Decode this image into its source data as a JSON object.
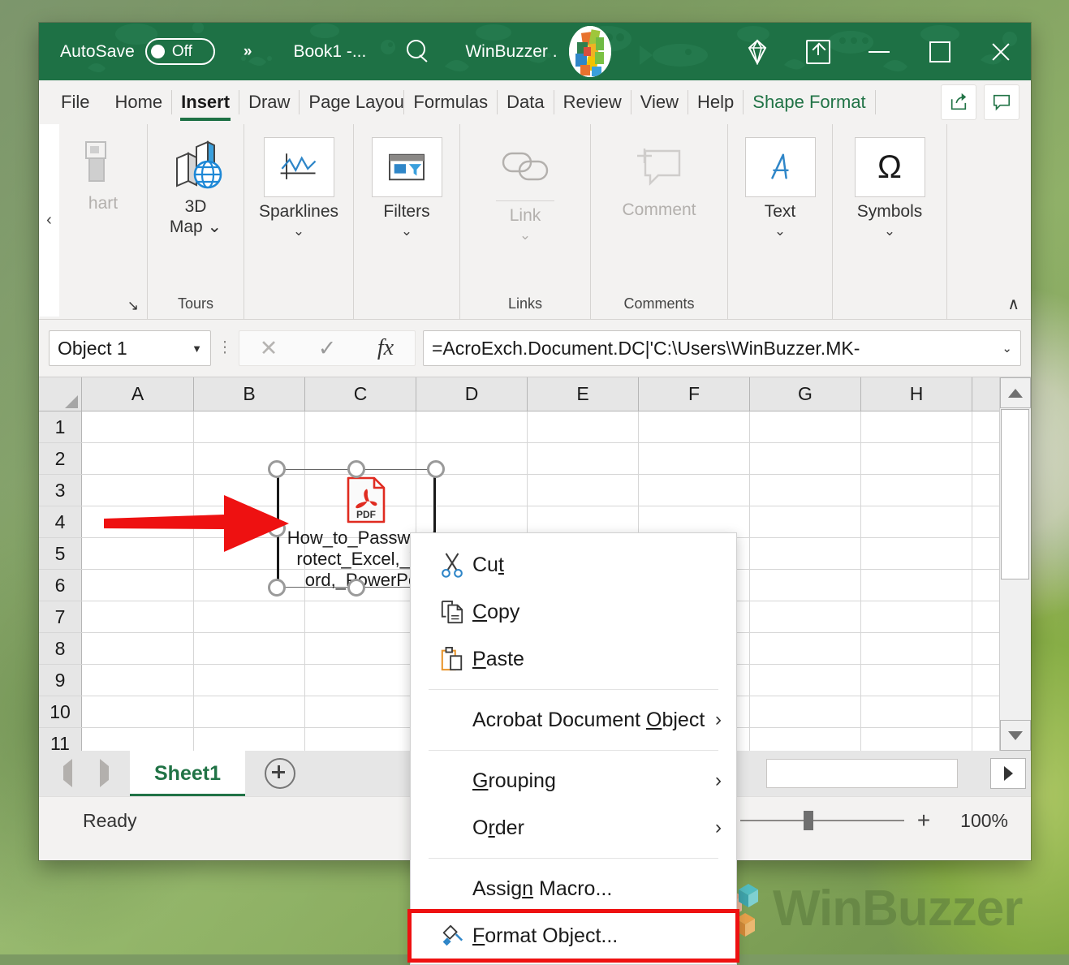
{
  "app": "Microsoft Excel",
  "titlebar": {
    "autosave_label": "AutoSave",
    "autosave_state": "Off",
    "qat_more": "»",
    "document_title": "Book1  -...",
    "search_icon": "search-icon",
    "user_name": "WinBuzzer .",
    "avatar": "user-avatar",
    "buttons": {
      "diamond": "diamond-icon",
      "ribbon_display": "ribbon-display-options-icon",
      "minimize": "minimize-icon",
      "maximize": "maximize-icon",
      "close": "close-icon"
    }
  },
  "tabs": [
    {
      "label": "File",
      "active": false,
      "contextual": false
    },
    {
      "label": "Home",
      "active": false,
      "contextual": false
    },
    {
      "label": "Insert",
      "active": true,
      "contextual": false
    },
    {
      "label": "Draw",
      "active": false,
      "contextual": false
    },
    {
      "label": "Page Layout",
      "active": false,
      "contextual": false,
      "clipped": true
    },
    {
      "label": "Formulas",
      "active": false,
      "contextual": false
    },
    {
      "label": "Data",
      "active": false,
      "contextual": false
    },
    {
      "label": "Review",
      "active": false,
      "contextual": false
    },
    {
      "label": "View",
      "active": false,
      "contextual": false
    },
    {
      "label": "Help",
      "active": false,
      "contextual": false
    },
    {
      "label": "Shape Format",
      "active": false,
      "contextual": true
    }
  ],
  "tabstrip_right": {
    "share": "share-icon",
    "comments": "comments-icon"
  },
  "ribbon": {
    "scroll_left": "‹",
    "groups": [
      {
        "name": "charts",
        "label": "",
        "clipped": true,
        "buttons": [
          {
            "label": "hart",
            "icon": "pivotchart-icon",
            "dim": true,
            "chevron": false
          }
        ],
        "dialog_launcher": "↘"
      },
      {
        "name": "tours",
        "label": "Tours",
        "buttons": [
          {
            "label": "3D\nMap ⌄",
            "icon": "3d-map-icon",
            "dim": false,
            "chevron": false
          }
        ]
      },
      {
        "name": "sparklines",
        "label": "",
        "buttons": [
          {
            "label": "Sparklines",
            "icon": "sparklines-icon",
            "dim": false,
            "chevron": true
          }
        ]
      },
      {
        "name": "filters",
        "label": "",
        "buttons": [
          {
            "label": "Filters",
            "icon": "filters-icon",
            "dim": false,
            "chevron": true
          }
        ]
      },
      {
        "name": "links",
        "label": "Links",
        "buttons": [
          {
            "label": "Link",
            "icon": "link-icon",
            "dim": true,
            "chevron": true
          }
        ]
      },
      {
        "name": "comments",
        "label": "Comments",
        "buttons": [
          {
            "label": "Comment",
            "icon": "new-comment-icon",
            "dim": true,
            "chevron": false
          }
        ]
      },
      {
        "name": "text",
        "label": "",
        "buttons": [
          {
            "label": "Text",
            "icon": "text-box-icon",
            "dim": false,
            "chevron": true
          }
        ]
      },
      {
        "name": "symbols",
        "label": "",
        "buttons": [
          {
            "label": "Symbols",
            "icon": "omega-symbol-icon",
            "dim": false,
            "chevron": true
          }
        ]
      }
    ],
    "collapse_glyph": "∧"
  },
  "formula_bar": {
    "name_box_value": "Object 1",
    "name_box_caret": "▼",
    "cancel_icon": "✕",
    "enter_icon": "✓",
    "fx_icon": "fx",
    "formula_value": "=AcroExch.Document.DC|'C:\\Users\\WinBuzzer.MK-",
    "expand_caret": "⌄"
  },
  "grid": {
    "columns": [
      "A",
      "B",
      "C",
      "D",
      "E",
      "F",
      "G",
      "H"
    ],
    "rows": [
      "1",
      "2",
      "3",
      "4",
      "5",
      "6",
      "7",
      "8",
      "9",
      "10",
      "11"
    ],
    "select_all_corner": "select-all-icon"
  },
  "embedded_object": {
    "type": "pdf",
    "icon_label": "PDF",
    "caption_lines": [
      "How_to_Password",
      "rotect_Excel,_W",
      "ord,_PowerPo"
    ],
    "selected": true
  },
  "annotation": {
    "arrow": "red-arrow-pointing-right",
    "arrow_color": "#ee1111",
    "highlight_color": "#ee1111"
  },
  "context_menu": {
    "items": [
      {
        "label": "Cut",
        "accel": "t",
        "icon": "scissors-icon",
        "submenu": false,
        "separator_after": false
      },
      {
        "label": "Copy",
        "accel": "C",
        "icon": "copy-icon",
        "submenu": false,
        "separator_after": false
      },
      {
        "label": "Paste",
        "accel": "P",
        "icon": "paste-icon",
        "submenu": false,
        "separator_after": true
      },
      {
        "label": "Acrobat Document Object",
        "accel": "O",
        "icon": "",
        "submenu": true,
        "separator_after": true
      },
      {
        "label": "Grouping",
        "accel": "G",
        "icon": "",
        "submenu": true,
        "separator_after": false
      },
      {
        "label": "Order",
        "accel": "r",
        "icon": "",
        "submenu": true,
        "separator_after": true
      },
      {
        "label": "Assign Macro...",
        "accel": "n",
        "icon": "",
        "submenu": false,
        "separator_after": false
      },
      {
        "label": "Format Object...",
        "accel": "F",
        "icon": "format-object-icon",
        "submenu": false,
        "separator_after": false,
        "highlighted": true
      }
    ],
    "submenu_arrow": "›"
  },
  "sheet_bar": {
    "prev_icon": "previous-sheet-icon",
    "next_icon": "next-sheet-icon",
    "sheets": [
      {
        "name": "Sheet1",
        "active": true
      }
    ],
    "add_sheet_icon": "add-sheet-icon",
    "hscroll_right_icon": "scroll-right-icon"
  },
  "status_bar": {
    "status": "Ready",
    "zoom_out_icon": "−",
    "zoom_in_icon": "+",
    "zoom_level": "100%"
  },
  "watermark": {
    "text": "WinBuzzer",
    "logo": "winbuzzer-logo"
  }
}
